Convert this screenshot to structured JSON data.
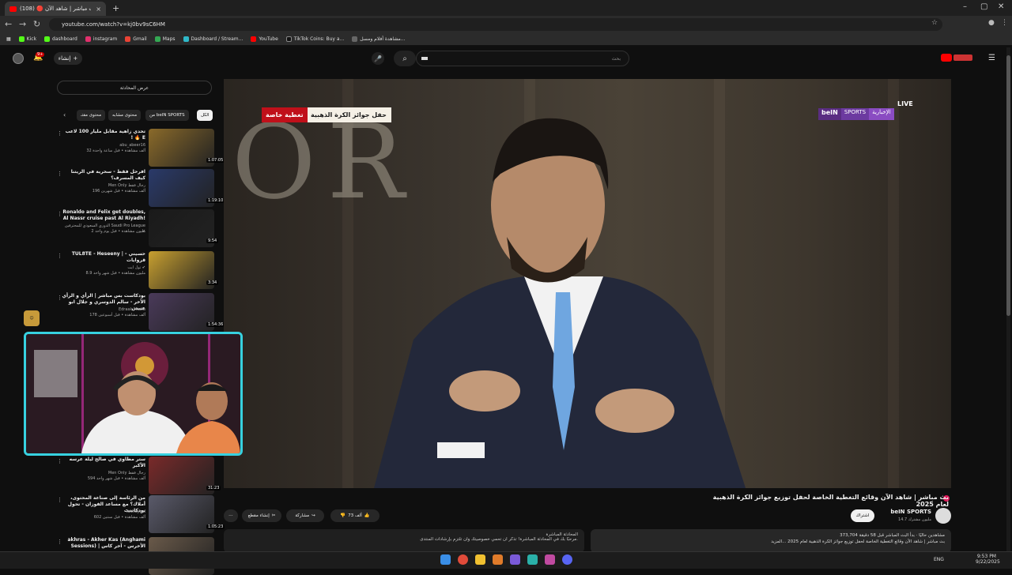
{
  "browser": {
    "tab_title": "(108) 🔴 بث مباشر | شاهد الآن",
    "url": "youtube.com/watch?v=kj0bv9sC6HM",
    "bookmarks": [
      "Kick",
      "dashboard",
      "instagram",
      "Gmail",
      "Maps",
      "Dashboard / Stream...",
      "YouTube",
      "TikTok Coins: Buy a...",
      "مشاهدة أفلام ومسل..."
    ]
  },
  "header": {
    "create_label": "إنشاء",
    "notif_count": "9+",
    "search_placeholder": "بحث",
    "search_value": ""
  },
  "sidebar": {
    "chat_button": "عرض المحادثة",
    "chips": [
      "الكل",
      "من beIN SPORTS",
      "محتوى مشابه",
      "محتوى مقتـ"
    ],
    "items": [
      {
        "title": "تحدي زاهية مقابل مليار 100 لاعب ! 🔥 E",
        "channel": "abu_abeer16",
        "meta": "32 ألف مشاهدة • قبل ساعة واحدة",
        "duration": "1:07:05",
        "thumb": "#8a6a2a"
      },
      {
        "title": "افرحل فقط - سحرية في الريتنا كيف المسرف؟",
        "channel": "Men Only رجال فقط",
        "meta": "196 ألف مشاهدة • قبل شهرين",
        "duration": "1:19:10",
        "thumb": "#2a3a6a"
      },
      {
        "title": "Ronaldo and Felix get doubles, Al Nassr cruise past Al Riyadh!",
        "channel": "الدوري السعودي للمحترفين Saudi Pro League ✔",
        "meta": "2 مليون مشاهدة • قبل يوم واحد",
        "duration": "9:54",
        "thumb": "#1a1a1a"
      },
      {
        "title": "TUL8TE - Heseeny | حسيني - قروايات",
        "channel": "تول ايت ✔",
        "meta": "8.9 مليون مشاهدة • قبل شهر واحد",
        "duration": "3:34",
        "thumb": "#c8a030"
      },
      {
        "title": "بودكاست بس مباشر | الرأي و الرأي الآخر - سالم الدوسري و جلال ابو عبيس",
        "channel": "Edraak Media",
        "meta": "178 ألف مشاهدة • قبل أسبوعين",
        "duration": "1:54:36",
        "thumb": "#4a3a5a"
      },
      {
        "title": "ستر مطاوي في صالح ليلة عرسه الأكبر",
        "channel": "Men Only رجال فقط",
        "meta": "594 ألف مشاهدة • قبل شهر واحد",
        "duration": "31:23",
        "thumb": "#7a2a2a"
      },
      {
        "title": "من الرئاسة إلى صناعة المحتوى، أملاك؟ مع مساعد الفوزان - تحول بودكاست",
        "channel": "Takhayaal",
        "meta": "602 ألف مشاهدة • قبل سنتين",
        "duration": "1:05:23",
        "thumb": "#5a5a6a"
      },
      {
        "title": "akhras - Akher Kas (Anghami Sessions) | الأخرس - آخر كاس",
        "channel": "",
        "meta": "",
        "duration": "",
        "thumb": "#6a5a4a"
      }
    ]
  },
  "player": {
    "banner_main": "حفل جوائز الكرة الذهبية",
    "banner_tag": "تغطية خاصة",
    "live_label": "LIVE",
    "channel_logo": [
      "beIN",
      "SPORTS",
      "الإخبارية"
    ],
    "bg_text": "OR"
  },
  "video": {
    "title": "بث مباشر | شاهد الآن وقائع التغطية الخاصة لحفل توزيع جوائز الكرة الذهبية لعام 2025",
    "channel": "beIN SPORTS",
    "subs": "14.7 مليون مشترك",
    "subscribe": "اشتراك",
    "likes": "73 ألف",
    "share": "مشاركة",
    "clip": "إنشاء مقطع",
    "watching": "373,704 مشاهدين حاليًا · بدأ البث المباشر قبل 58 دقيقة",
    "description": "بث مباشر | شاهد الآن وقائع التغطية الخاصة لحفل توزيع جوائز الكرة الذهبية لعام 2025 ...المزيد",
    "live_chat_label": "المحادثة المباشرة",
    "chat_preview": "مرحبًا بك في المحادثة المباشرة! تذكّر أن تحمي خصوصيتك وأن تلتزم بإرشادات المنتدى."
  },
  "taskbar": {
    "time": "9:53 PM",
    "date": "9/22/2025",
    "lang": "ENG"
  }
}
